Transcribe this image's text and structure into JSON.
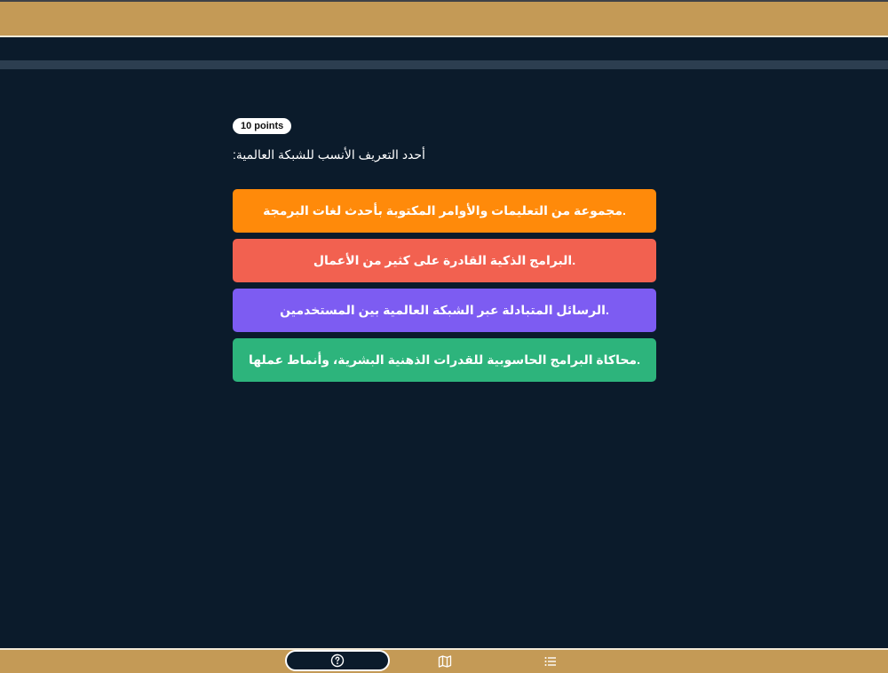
{
  "question": {
    "points_label": "10 points",
    "prompt": ":أحدد التعريف الأنسب للشبكة العالمية"
  },
  "options": [
    {
      "label": "مجموعة من التعليمات والأوامر المكتوبة بأحدث لغات البرمجة.",
      "color": "#ff8a0a"
    },
    {
      "label": "البرامج الذكية القادرة على كثير من الأعمال.",
      "color": "#f26150"
    },
    {
      "label": "الرسائل المتبادلة عبر الشبكة العالمية بين المستخدمين.",
      "color": "#7d5cf2"
    },
    {
      "label": "محاكاة البرامج الحاسوبية للقدرات الذهنية البشرية، وأنماط عملها.",
      "color": "#2db47c"
    }
  ],
  "bottom_bar": {
    "icons": [
      "question-circle-icon",
      "map-icon",
      "list-icon"
    ]
  },
  "colors": {
    "frame": "#c49a56",
    "background": "#0b1b2b",
    "progress_track": "#2c3e50"
  }
}
